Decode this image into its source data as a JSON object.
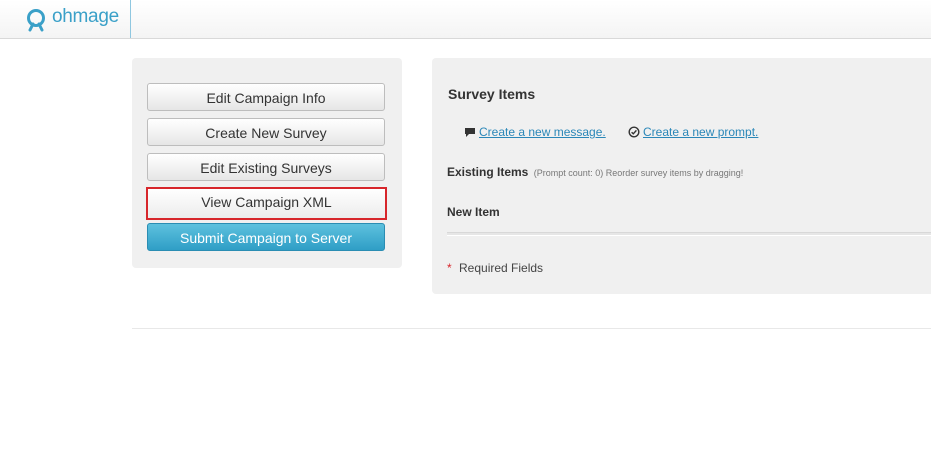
{
  "header": {
    "brand": "ohmage",
    "icon": "ohmage-logo-icon",
    "brand_color": "#3aa0c8"
  },
  "sidebar": {
    "buttons": [
      {
        "label": "Edit Campaign Info"
      },
      {
        "label": "Create New Survey"
      },
      {
        "label": "Edit Existing Surveys"
      },
      {
        "label": "View Campaign XML",
        "highlighted": true
      },
      {
        "label": "Submit Campaign to Server",
        "primary": true
      }
    ]
  },
  "survey_items": {
    "title": "Survey Items",
    "create_message": " Create a new message.",
    "create_prompt": " Create a new prompt.",
    "existing_label": "Existing Items",
    "existing_note": "(Prompt count: 0) Reorder survey items by dragging!",
    "new_item_label": "New Item",
    "required_star": "*",
    "required_text": "Required Fields"
  },
  "colors": {
    "highlight_border": "#d7262b",
    "primary_button": "#3aa9d0",
    "link": "#2a87b8"
  }
}
